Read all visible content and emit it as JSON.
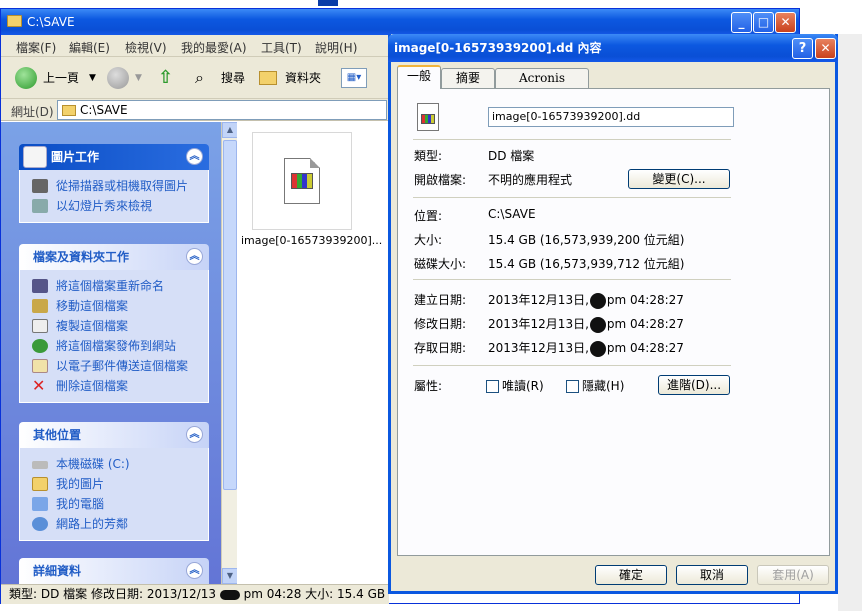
{
  "explorer": {
    "title": "C:\\SAVE",
    "menu": [
      "檔案(F)",
      "編輯(E)",
      "檢視(V)",
      "我的最愛(A)",
      "工具(T)",
      "說明(H)"
    ],
    "toolbar": {
      "back": "上一頁",
      "search": "搜尋",
      "folders": "資料夾"
    },
    "address_label": "網址(D)",
    "address_value": "C:\\SAVE",
    "panels": [
      {
        "title": "圖片工作",
        "tasks": [
          "從掃描器或相機取得圖片",
          "以幻燈片秀來檢視"
        ]
      },
      {
        "title": "檔案及資料夾工作",
        "tasks": [
          "將這個檔案重新命名",
          "移動這個檔案",
          "複製這個檔案",
          "將這個檔案發佈到網站",
          "以電子郵件傳送這個檔案",
          "刪除這個檔案"
        ]
      },
      {
        "title": "其他位置",
        "tasks": [
          "本機磁碟 (C:)",
          "我的圖片",
          "我的電腦",
          "網路上的芳鄰"
        ]
      },
      {
        "title": "詳細資料",
        "tasks": []
      }
    ],
    "file_name": "image[0-16573939200]...",
    "status": {
      "prefix": "類型: DD 檔案 修改日期: 2013/12/13",
      "suffix": "pm 04:28 大小: 15.4 GB"
    }
  },
  "dialog": {
    "title": "image[0-16573939200].dd 內容",
    "tabs": [
      "一般",
      "摘要",
      "Acronis Recovery"
    ],
    "file_name": "image[0-16573939200].dd",
    "type_label": "類型:",
    "type_value": "DD 檔案",
    "open_label": "開啟檔案:",
    "open_value": "不明的應用程式",
    "change_button": "變更(C)...",
    "location_label": "位置:",
    "location_value": "C:\\SAVE",
    "size_label": "大小:",
    "size_value": "15.4 GB (16,573,939,200 位元組)",
    "disk_size_label": "磁碟大小:",
    "disk_size_value": "15.4 GB (16,573,939,712 位元組)",
    "created_label": "建立日期:",
    "created_date": "2013年12月13日,",
    "created_time": "pm 04:28:27",
    "modified_label": "修改日期:",
    "modified_date": "2013年12月13日,",
    "modified_time": "pm 04:28:27",
    "accessed_label": "存取日期:",
    "accessed_date": "2013年12月13日,",
    "accessed_time": "pm 04:28:27",
    "attributes_label": "屬性:",
    "readonly_label": "唯讀(R)",
    "hidden_label": "隱藏(H)",
    "advanced_button": "進階(D)...",
    "ok": "確定",
    "cancel": "取消",
    "apply": "套用(A)"
  }
}
